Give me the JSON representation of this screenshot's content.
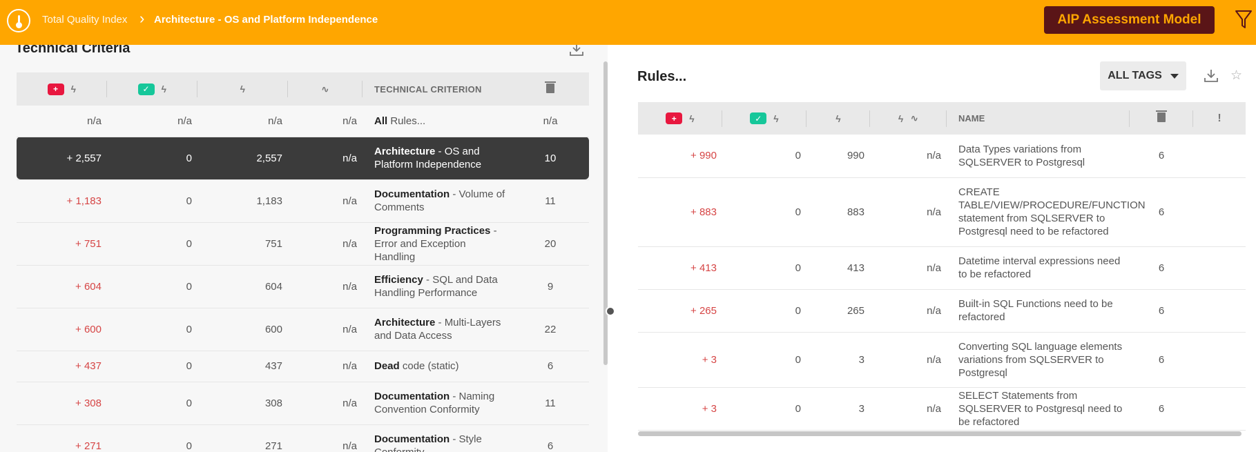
{
  "topbar": {
    "breadcrumb_root": "Total Quality Index",
    "breadcrumb_separator": "›",
    "breadcrumb_current": "Architecture - OS and Platform Independence",
    "model_button": "AIP Assessment Model",
    "colors": {
      "bar": "#ffa600",
      "button": "#5a1517",
      "button_text": "#ffa600"
    }
  },
  "left": {
    "title": "Technical Criteria",
    "header": {
      "added_badge": "+",
      "removed_badge": "✓",
      "criterion": "TECHNICAL CRITERION"
    },
    "rows": [
      {
        "added": "n/a",
        "removed": "n/a",
        "total": "n/a",
        "trend": "n/a",
        "crit_bold": "All",
        "crit_rest": " Rules...",
        "count": "n/a"
      },
      {
        "added": "+ 2,557",
        "removed": "0",
        "total": "2,557",
        "trend": "n/a",
        "crit_bold": "Architecture",
        "crit_rest": " - OS and Platform Independence",
        "count": "10"
      },
      {
        "added": "+ 1,183",
        "removed": "0",
        "total": "1,183",
        "trend": "n/a",
        "crit_bold": "Documentation",
        "crit_rest": " - Volume of Comments",
        "count": "11"
      },
      {
        "added": "+ 751",
        "removed": "0",
        "total": "751",
        "trend": "n/a",
        "crit_bold": "Programming Practices",
        "crit_rest": " - Error and Exception Handling",
        "count": "20"
      },
      {
        "added": "+ 604",
        "removed": "0",
        "total": "604",
        "trend": "n/a",
        "crit_bold": "Efficiency",
        "crit_rest": " - SQL and Data Handling Performance",
        "count": "9"
      },
      {
        "added": "+ 600",
        "removed": "0",
        "total": "600",
        "trend": "n/a",
        "crit_bold": "Architecture",
        "crit_rest": " - Multi-Layers and Data Access",
        "count": "22"
      },
      {
        "added": "+ 437",
        "removed": "0",
        "total": "437",
        "trend": "n/a",
        "crit_bold": "Dead",
        "crit_rest": " code (static)",
        "count": "6"
      },
      {
        "added": "+ 308",
        "removed": "0",
        "total": "308",
        "trend": "n/a",
        "crit_bold": "Documentation",
        "crit_rest": " - Naming Convention Conformity",
        "count": "11"
      },
      {
        "added": "+ 271",
        "removed": "0",
        "total": "271",
        "trend": "n/a",
        "crit_bold": "Documentation",
        "crit_rest": " - Style Conformity",
        "count": "6"
      }
    ]
  },
  "right": {
    "title": "Rules...",
    "tags_button": "ALL TAGS",
    "header": {
      "name": "NAME",
      "added_badge": "+",
      "removed_badge": "✓",
      "critical": "!"
    },
    "rows": [
      {
        "added": "+ 990",
        "removed": "0",
        "total": "990",
        "trend": "n/a",
        "name": "Data Types variations from SQLSERVER to Postgresql",
        "count": "6"
      },
      {
        "added": "+ 883",
        "removed": "0",
        "total": "883",
        "trend": "n/a",
        "name": "CREATE TABLE/VIEW/PROCEDURE/FUNCTION statement from SQLSERVER to Postgresql need to be refactored",
        "count": "6"
      },
      {
        "added": "+ 413",
        "removed": "0",
        "total": "413",
        "trend": "n/a",
        "name": "Datetime interval expressions need to be refactored",
        "count": "6"
      },
      {
        "added": "+ 265",
        "removed": "0",
        "total": "265",
        "trend": "n/a",
        "name": "Built-in SQL Functions need to be refactored",
        "count": "6"
      },
      {
        "added": "+ 3",
        "removed": "0",
        "total": "3",
        "trend": "n/a",
        "name": "Converting SQL language elements variations from SQLSERVER to Postgresql",
        "count": "6"
      },
      {
        "added": "+ 3",
        "removed": "0",
        "total": "3",
        "trend": "n/a",
        "name": "SELECT Statements from SQLSERVER to Postgresql need to be refactored",
        "count": "6"
      }
    ]
  }
}
